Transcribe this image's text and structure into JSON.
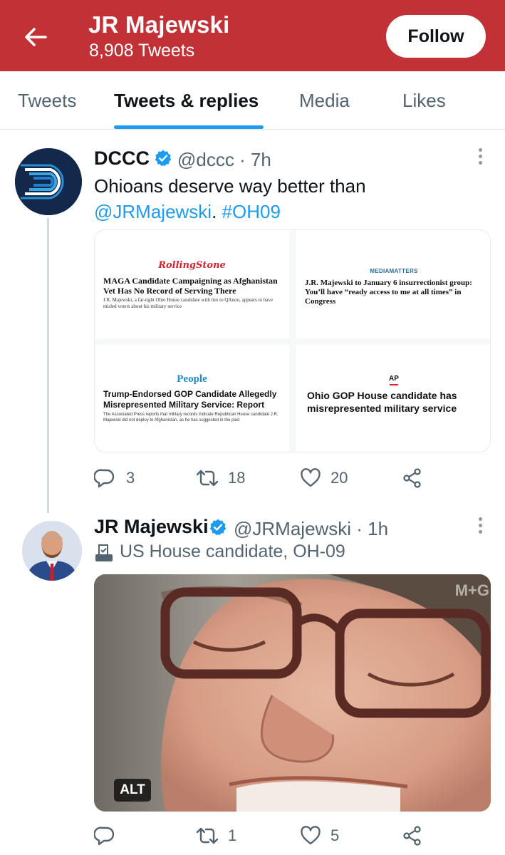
{
  "header": {
    "title": "JR Majewski",
    "tweet_count": "8,908 Tweets",
    "follow_label": "Follow",
    "bg_color": "#c13136"
  },
  "tabs": [
    {
      "label": "Tweets",
      "active": false
    },
    {
      "label": "Tweets & replies",
      "active": true
    },
    {
      "label": "Media",
      "active": false
    },
    {
      "label": "Likes",
      "active": false
    }
  ],
  "tweets": [
    {
      "name": "DCCC",
      "verified": true,
      "handle_time": "@dccc · 7h",
      "text_line1": "Ohioans deserve way better than",
      "mention": "@JRMajewski",
      "separator": ".",
      "hashtag": "#OH09",
      "cards": [
        {
          "publication": "RollingStone",
          "headline": "MAGA Candidate Campaigning as Afghanistan Vet Has No Record of Serving There",
          "subhead": "J.R. Majewski, a far-right Ohio House candidate with ties to QAnon, appears to have misled voters about his military service"
        },
        {
          "publication": "MEDIAMATTERS",
          "headline": "J.R. Majewski to January 6 insurrectionist group: You’ll have “ready access to me at all times” in Congress"
        },
        {
          "publication": "People",
          "headline": "Trump-Endorsed GOP Candidate Allegedly Misrepresented Military Service: Report",
          "subhead": "The Associated Press reports that military records indicate Republican House candidate J.R. Majewski did not deploy to Afghanistan, as he has suggested in the past"
        },
        {
          "publication": "AP",
          "headline": "Ohio GOP House candidate has misrepresented military service"
        }
      ],
      "replies": "3",
      "retweets": "18",
      "likes": "20"
    },
    {
      "name": "JR Majewski",
      "verified": true,
      "handle_time": "@JRMajewski · 1h",
      "bio_icon": "ballot-box-icon",
      "bio": "US House candidate, OH-09",
      "media_alt_badge": "ALT",
      "media_watermark": "M+G",
      "replies": "",
      "retweets": "1",
      "likes": "5"
    }
  ],
  "colors": {
    "accent": "#1d9bf0",
    "verified": "#1d9bf0",
    "secondary_text": "#536471"
  }
}
